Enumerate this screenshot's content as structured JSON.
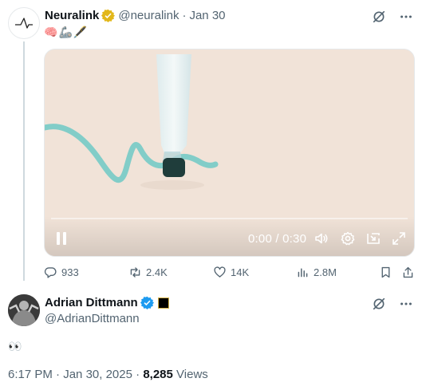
{
  "parent_tweet": {
    "display_name": "Neuralink",
    "handle": "@neuralink",
    "separator": "·",
    "date": "Jan 30",
    "emoji": [
      "🧠",
      "🦾",
      "🖋️"
    ],
    "video": {
      "current_time": "0:00",
      "time_divider": "/",
      "duration": "0:30",
      "progress_fraction": 0.0
    },
    "metrics": {
      "replies": "933",
      "reposts": "2.4K",
      "likes": "14K",
      "views": "2.8M"
    }
  },
  "main_tweet": {
    "display_name": "Adrian Dittmann",
    "handle": "@AdrianDittmann",
    "text": "👀",
    "time": "6:17 PM",
    "separator": "·",
    "date": "Jan 30, 2025",
    "separator2": "·",
    "views_count": "8,285",
    "views_label": "Views"
  },
  "colors": {
    "gold_badge": "#e2b719",
    "blue_badge": "#1d9bf0",
    "muted_text": "#536471",
    "thread_line": "#cfd9de"
  },
  "icons": {
    "grok": "grok-icon",
    "more": "more-icon",
    "reply": "reply-icon",
    "repost": "repost-icon",
    "like": "like-icon",
    "views": "views-chart-icon",
    "bookmark": "bookmark-icon",
    "share": "share-icon",
    "volume": "volume-icon",
    "settings": "settings-icon",
    "pip": "pip-icon",
    "fullscreen": "fullscreen-icon"
  }
}
